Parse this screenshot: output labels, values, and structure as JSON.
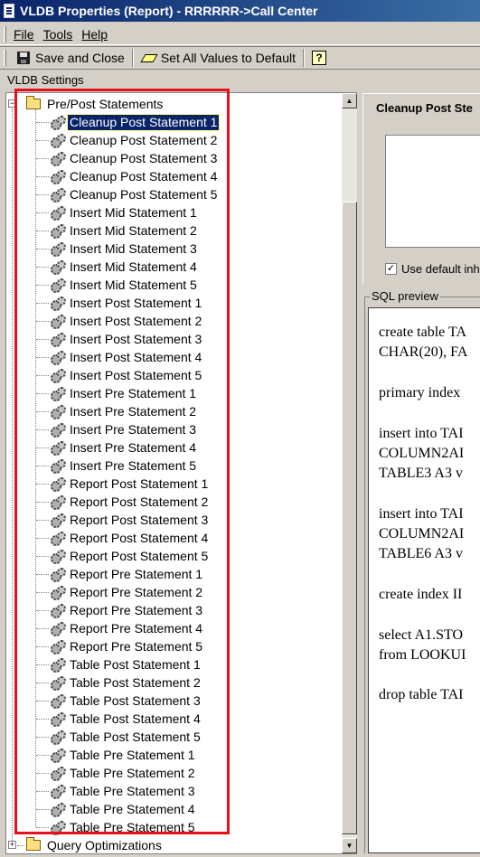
{
  "window": {
    "title": "VLDB Properties (Report) - RRRRRR->Call Center"
  },
  "menu": [
    "File",
    "Tools",
    "Help"
  ],
  "toolbar": {
    "save_label": "Save and Close",
    "default_label": "Set All Values to Default",
    "help_label": "?"
  },
  "section_label": "VLDB Settings",
  "tree": {
    "root": "Pre/Post Statements",
    "selected_index": 0,
    "items": [
      "Cleanup Post Statement 1",
      "Cleanup Post Statement 2",
      "Cleanup Post Statement 3",
      "Cleanup Post Statement 4",
      "Cleanup Post Statement 5",
      "Insert Mid Statement 1",
      "Insert Mid Statement 2",
      "Insert Mid Statement 3",
      "Insert Mid Statement 4",
      "Insert Mid Statement 5",
      "Insert Post Statement 1",
      "Insert Post Statement 2",
      "Insert Post Statement 3",
      "Insert Post Statement 4",
      "Insert Post Statement 5",
      "Insert Pre Statement 1",
      "Insert Pre Statement 2",
      "Insert Pre Statement 3",
      "Insert Pre Statement 4",
      "Insert Pre Statement 5",
      "Report Post Statement 1",
      "Report Post Statement 2",
      "Report Post Statement 3",
      "Report Post Statement 4",
      "Report Post Statement 5",
      "Report Pre Statement 1",
      "Report Pre Statement 2",
      "Report Pre Statement 3",
      "Report Pre Statement 4",
      "Report Pre Statement 5",
      "Table Post Statement 1",
      "Table Post Statement 2",
      "Table Post Statement 3",
      "Table Post Statement 4",
      "Table Post Statement 5",
      "Table Pre Statement 1",
      "Table Pre Statement 2",
      "Table Pre Statement 3",
      "Table Pre Statement 4",
      "Table Pre Statement 5"
    ],
    "next_root": "Query Optimizations"
  },
  "option_panel": {
    "title": "Cleanup Post Ste",
    "checkbox_label": "Use default inh",
    "checked": true
  },
  "sql_preview": {
    "label": "SQL preview",
    "lines": [
      "create table TA",
      "CHAR(20), FA",
      "",
      "primary index",
      "",
      "insert into TAI",
      "COLUMN2AI",
      "TABLE3 A3 v",
      "",
      "insert into TAI",
      "COLUMN2AI",
      "TABLE6 A3 v",
      "",
      "create index II",
      "",
      "select A1.STO",
      "from LOOKUI",
      "",
      "drop table TAI"
    ]
  },
  "colors": {
    "highlight_box": "#e8101c",
    "selection": "#0a246a",
    "titlebar": "#0a246a"
  }
}
